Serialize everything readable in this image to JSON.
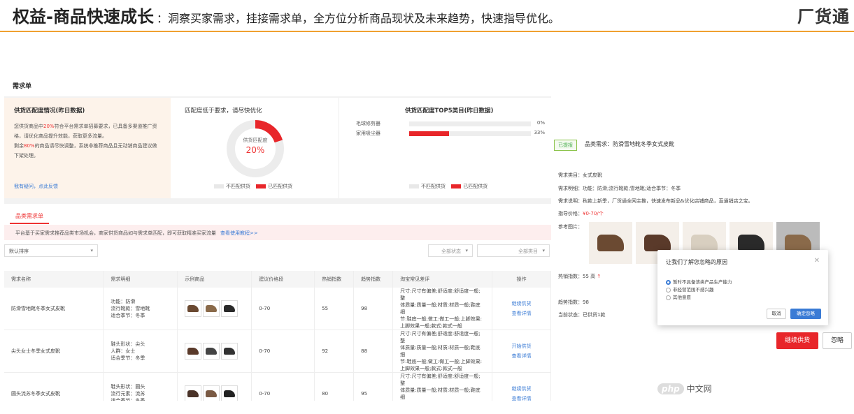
{
  "slide": {
    "title": "权益-商品快速成长",
    "subtitle": "：洞察买家需求，挂接需求单，全方位分析商品现状及未来趋势，快速指导优化。",
    "logo": "厂货通",
    "accent": "#f0a030"
  },
  "left_panel": {
    "title": "需求单",
    "summary": {
      "heading": "供货匹配度情况(昨日数据)",
      "text_a": "您供货商品中",
      "text_pct1": "20%",
      "text_b": "符合平台需求单招募要求，已具备多渠道推广资格，请优化商品提升效能，获取更多流量。",
      "text_c": "剩余",
      "text_pct2": "80%",
      "text_d": "的商品请尽快调整，系统非推荐商品且无动销商品建议做下架处理。",
      "feedback": "我有疑问，点此反馈"
    },
    "match": {
      "heading": "匹配度低于要求，请尽快优化",
      "donut_label": "供货匹配度",
      "donut_value": "20%",
      "donut_fraction": 0.2,
      "legend_unmatched": "不匹配供货",
      "legend_matched": "已匹配供货"
    },
    "top5": {
      "heading": "供货匹配度TOP5类目(昨日数据)",
      "rows": [
        {
          "label": "毛球修剪器",
          "pct": "0%",
          "value": 0
        },
        {
          "label": "家用吸尘器",
          "pct": "33%",
          "value": 0.33
        }
      ],
      "legend_unmatched": "不匹配供货",
      "legend_matched": "已匹配供货"
    },
    "tab": "品类需求单",
    "notice": "平台基于买家需求推荐品类市场机会，商家供货商品如与需求单匹配，即可获取精准买家流量",
    "notice_link": "查看使用教程>>",
    "sort": "默认排序",
    "filter_status": "全部状态",
    "filter_category": "全部类目",
    "columns": [
      "需求名称",
      "需求明细",
      "示例商品",
      "建议价格段",
      "热销指数",
      "趋势指数",
      "淘宝常见差评",
      "操作"
    ],
    "rows": [
      {
        "name": "防滑雪地靴冬季女式皮靴",
        "detail": [
          "功能：防滑",
          "流行靴款：雪地靴",
          "适合季节：冬季"
        ],
        "price": "0-70",
        "hot": "55",
        "trend": "98",
        "review": [
          "尺寸:尺寸有偏差;舒适度:舒适度一般;整",
          "体质量:质量一般;材质:材质一般;鞋底细",
          "节:鞋底一般;做工:做工一般;上脚效果:",
          "上脚效果一般;款式:款式一般"
        ],
        "action1": "继续供货",
        "action2": "查看详情",
        "colors": [
          "#6b4a32",
          "#8a6a4a",
          "#2a2a2a"
        ]
      },
      {
        "name": "尖头女士冬季女式皮靴",
        "detail": [
          "鞋头形状：尖头",
          "人群：女士",
          "适合季节：冬季"
        ],
        "price": "0-70",
        "hot": "92",
        "trend": "88",
        "review": [
          "尺寸:尺寸有偏差;舒适度:舒适度一般;整",
          "体质量:质量一般;材质:材质一般;鞋底细",
          "节:鞋底一般;做工:做工一般;上脚效果:",
          "上脚效果一般;款式:款式一般"
        ],
        "action1": "开始供货",
        "action2": "查看详情",
        "colors": [
          "#5a3a2a",
          "#444444",
          "#333333"
        ]
      },
      {
        "name": "圆头流苏冬季女式皮靴",
        "detail": [
          "鞋头形状：圆头",
          "流行元素：流苏",
          "适合季节：冬季"
        ],
        "price": "0-70",
        "hot": "80",
        "trend": "95",
        "review": [
          "尺寸:尺寸有偏差;舒适度:舒适度一般;整",
          "体质量:质量一般;材质:材质一般;鞋底细",
          "节:鞋底一般;做工:做工一般;上脚效果:",
          "上脚效果一般;款式:款式一般"
        ],
        "action1": "继续供货",
        "action2": "查看详情",
        "colors": [
          "#4a3328",
          "#7a5a44",
          "#222222"
        ]
      }
    ]
  },
  "right_panel": {
    "tag": "已提报",
    "title": "品类需求：防滑雪地靴冬季女式皮靴",
    "category": "需求类目：女式皮靴",
    "detail": "需求明细：功能：防滑;流行靴款;雪地靴;适合季节：冬季",
    "desc": "需求说明：秋款上新季，厂货通全网主推，快速发布新品&优化店铺商品，直通销店之宝。",
    "price_label": "指导价格：",
    "price_value": "¥0-70/个",
    "ref_label": "参考图片：",
    "hot": "热销指数：55 高",
    "trend": "趋势指数：98",
    "status": "当前状态：已供货1款",
    "btn_continue": "继续供货",
    "btn_ignore": "忽略",
    "ref_colors": [
      "#6b4a32",
      "#5a3a2a",
      "#d8cfc0",
      "#2a2a2a",
      "#8a6a4a"
    ],
    "dialog": {
      "title": "让我们了解您忽略的原因",
      "opt1": "暂时不具备该类产品生产能力",
      "opt2": "非经营范围不感兴趣",
      "opt3": "其他意愿",
      "cancel": "取消",
      "ok": "确定忽略"
    }
  },
  "watermark": {
    "badge": "php",
    "text": "中文网"
  }
}
